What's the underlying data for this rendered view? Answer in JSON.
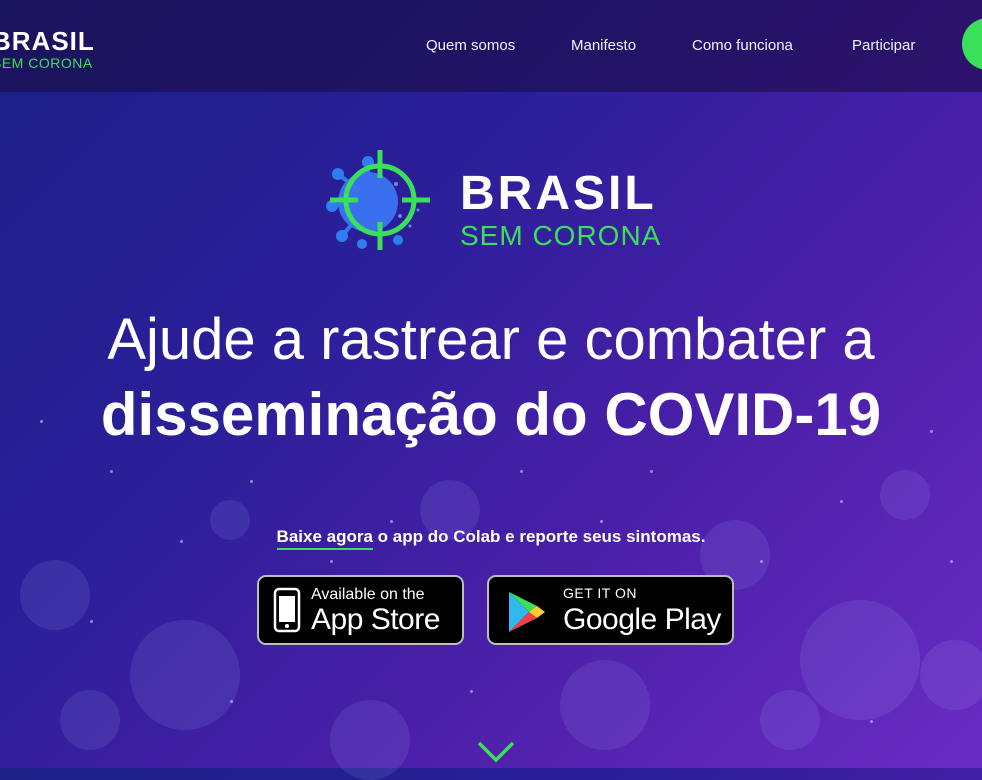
{
  "header": {
    "brand": {
      "line1": "BRASIL",
      "line2": "SEM CORONA"
    },
    "nav": [
      {
        "label": "Quem somos"
      },
      {
        "label": "Manifesto"
      },
      {
        "label": "Como funciona"
      },
      {
        "label": "Participar"
      }
    ]
  },
  "hero": {
    "brand": {
      "line1": "BRASIL",
      "line2": "SEM CORONA"
    },
    "headline_line1": "Ajude a rastrear e combater a",
    "headline_line2": "disseminação do COVID-19",
    "subtitle_highlight": "Baixe agora",
    "subtitle_rest": " o app do Colab e reporte seus sintomas.",
    "app_store": {
      "small": "Available on the",
      "big": "App Store"
    },
    "google_play": {
      "small": "GET IT ON",
      "big": "Google Play"
    }
  },
  "colors": {
    "accent_green": "#3be05a",
    "background_start": "#1c1f86",
    "background_end": "#6a2cc4"
  },
  "icons": [
    "virus-target-logo-icon",
    "phone-icon",
    "play-store-icon",
    "chevron-down-icon"
  ]
}
